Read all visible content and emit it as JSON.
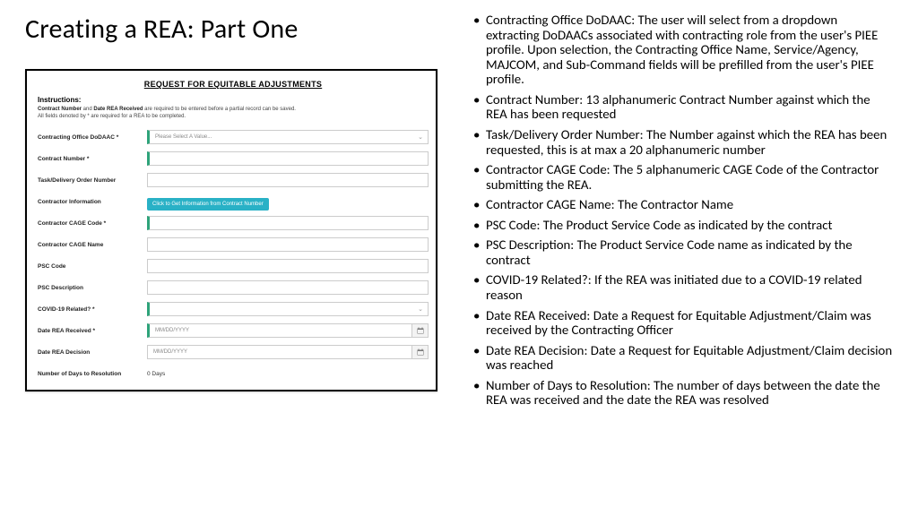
{
  "title": "Creating a REA: Part One",
  "form": {
    "heading": "REQUEST FOR EQUITABLE ADJUSTMENTS",
    "instructions_label": "Instructions:",
    "instr1_a": "Contract Number",
    "instr1_mid": " and ",
    "instr1_b": "Date REA Received",
    "instr1_tail": " are required to be entered before a partial record can be saved.",
    "instr2": "All fields denoted by * are required for a REA to be completed.",
    "labels": {
      "dodaac": "Contracting Office DoDAAC *",
      "contract": "Contract Number *",
      "task": "Task/Delivery Order Number",
      "ctrinfo": "Contractor Information",
      "cage": "Contractor CAGE Code *",
      "cagename": "Contractor CAGE Name",
      "psc": "PSC Code",
      "pscdesc": "PSC Description",
      "covid": "COVID-19 Related? *",
      "received": "Date REA Received *",
      "decision": "Date REA Decision",
      "days": "Number of Days to Resolution"
    },
    "placeholders": {
      "select": "Please Select A Value...",
      "date": "MM/DD/YYYY"
    },
    "info_btn": "Click to Get Information from Contract Number",
    "days_val": "0 Days"
  },
  "bullets": [
    "Contracting Office DoDAAC: The user will select from a dropdown extracting DoDAACs associated with contracting role from the user's PIEE profile. Upon selection, the Contracting Office Name, Service/Agency, MAJCOM, and Sub-Command fields will be prefilled from the user's PIEE profile.",
    "Contract Number: 13 alphanumeric Contract Number against which the REA has been requested",
    "Task/Delivery Order Number: The Number against which the REA has been requested, this is at max a 20 alphanumeric number",
    "Contractor CAGE Code: The 5 alphanumeric CAGE Code of the Contractor submitting the REA.",
    "Contractor CAGE Name: The Contractor Name",
    "PSC Code: The Product Service Code as indicated by the contract",
    "PSC Description: The Product Service Code name as indicated by the contract",
    "COVID-19 Related?: If the REA was initiated due to a COVID-19 related reason",
    "Date REA Received: Date a Request for Equitable Adjustment/Claim was received by the Contracting Officer",
    "Date REA Decision: Date a Request for Equitable Adjustment/Claim decision was reached",
    "Number of Days to Resolution: The number of days between the date the REA was received and the date the REA was resolved"
  ]
}
